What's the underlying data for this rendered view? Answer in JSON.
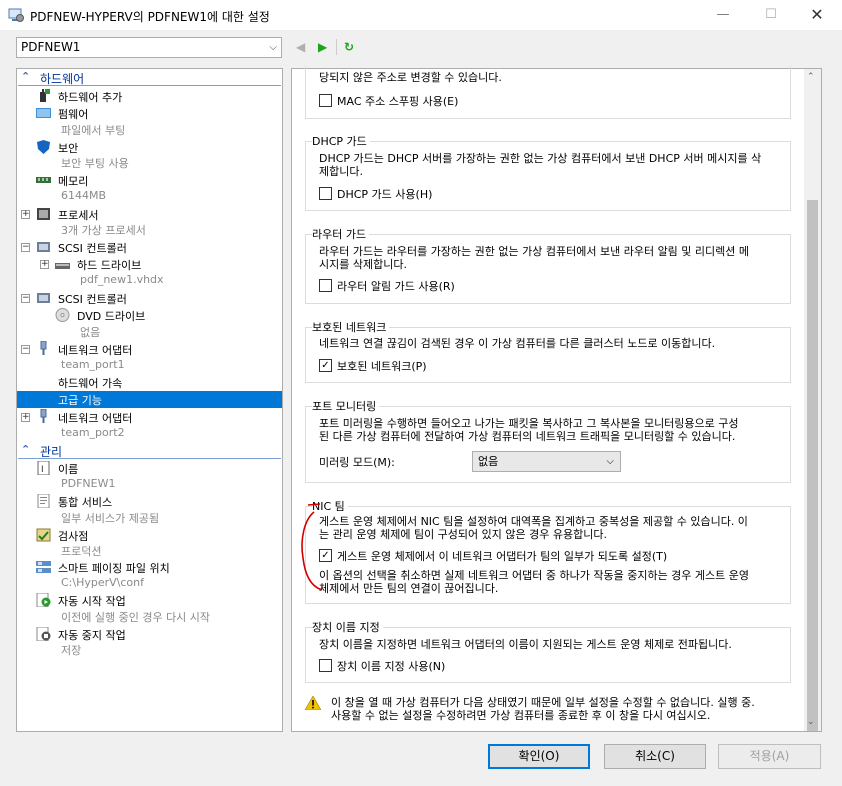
{
  "window": {
    "title": "PDFNEW-HYPERV의 PDFNEW1에 대한 설정",
    "minimize": "—",
    "maximize": "☐",
    "close": "✕"
  },
  "vm_select": {
    "value": "PDFNEW1"
  },
  "sidebar": {
    "hardware_header": "하드웨어",
    "management_header": "관리",
    "items": [
      {
        "label": "하드웨어 추가"
      },
      {
        "label": "펌웨어",
        "sub": "파일에서 부팅"
      },
      {
        "label": "보안",
        "sub": "보안 부팅 사용"
      },
      {
        "label": "메모리",
        "sub": "6144MB"
      },
      {
        "label": "프로세서",
        "sub": "3개 가상 프로세서"
      },
      {
        "label": "SCSI 컨트롤러"
      },
      {
        "label": "하드 드라이브",
        "sub": "pdf_new1.vhdx"
      },
      {
        "label": "SCSI 컨트롤러"
      },
      {
        "label": "DVD 드라이브",
        "sub": "없음"
      },
      {
        "label": "네트워크 어댑터",
        "sub": "team_port1"
      },
      {
        "label": "하드웨어 가속"
      },
      {
        "label": "고급 기능"
      },
      {
        "label": "네트워크 어댑터",
        "sub": "team_port2"
      }
    ],
    "mgmt_items": [
      {
        "label": "이름",
        "sub": "PDFNEW1"
      },
      {
        "label": "통합 서비스",
        "sub": "일부 서비스가 제공됨"
      },
      {
        "label": "검사점",
        "sub": "프로덕션"
      },
      {
        "label": "스마트 페이징 파일 위치",
        "sub": "C:\\HyperV\\conf"
      },
      {
        "label": "자동 시작 작업",
        "sub": "이전에 실행 중인 경우 다시 시작"
      },
      {
        "label": "자동 중지 작업",
        "sub": "저장"
      }
    ]
  },
  "main": {
    "mac": {
      "top_text": "당되지 않은 주소로 변경할 수 있습니다.",
      "checkbox": "MAC 주소 스푸핑 사용(E)",
      "checked": false
    },
    "dhcp": {
      "title": "DHCP 가드",
      "line1": "DHCP 가드는 DHCP 서버를 가장하는 권한 없는 가상 컴퓨터에서 보낸 DHCP 서버 메시지를 삭",
      "line2": "제합니다.",
      "checkbox": "DHCP 가드 사용(H)",
      "checked": false
    },
    "router": {
      "title": "라우터 가드",
      "line1": "라우터 가드는 라우터를 가장하는 권한 없는 가상 컴퓨터에서 보낸 라우터 알림 및 리디렉션 메",
      "line2": "시지를 삭제합니다.",
      "checkbox": "라우터 알림 가드 사용(R)",
      "checked": false
    },
    "protected": {
      "title": "보호된 네트워크",
      "line1": "네트워크 연결 끊김이 검색된 경우 이 가상 컴퓨터를 다른 클러스터 노드로 이동합니다.",
      "checkbox": "보호된 네트워크(P)",
      "checked": true
    },
    "port_monitor": {
      "title": "포트 모니터링",
      "line1": "포트 미러링을 수행하면 들어오고 나가는 패킷을 복사하고 그 복사본을 모니터링용으로 구성",
      "line2": "된 다른 가상 컴퓨터에 전달하여 가상 컴퓨터의 네트워크 트래픽을 모니터링할 수 있습니다.",
      "mode_label": "미러링 모드(M):",
      "mode_value": "없음"
    },
    "nic_team": {
      "title": "NIC 팀",
      "line1": "게스트 운영 체제에서 NIC 팀을 설정하여 대역폭을 집계하고 중복성을 제공할 수 있습니다. 이",
      "line2": "는 관리 운영 체제에 팀이 구성되어 있지 않은 경우 유용합니다.",
      "checkbox": "게스트 운영 체제에서 이 네트워크 어댑터가 팀의 일부가 되도록 설정(T)",
      "checked": true,
      "note1": "이 옵션의 선택을 취소하면 실제 네트워크 어댑터 중 하나가 작동을 중지하는 경우 게스트 운영",
      "note2": "체제에서 만든 팀의 연결이 끊어집니다."
    },
    "device_naming": {
      "title": "장치 이름 지정",
      "line1": "장치 이름을 지정하면 네트워크 어댑터의 이름이 지원되는 게스트 운영 체제로 전파됩니다.",
      "checkbox": "장치 이름 지정 사용(N)",
      "checked": false
    },
    "warning": {
      "line1": "이 창을 열 때 가상 컴퓨터가 다음 상태였기 때문에 일부 설정을 수정할 수 없습니다. 실행 중.",
      "line2": "사용할 수 없는 설정을 수정하려면 가상 컴퓨터를 종료한 후 이 창을 다시 여십시오."
    }
  },
  "buttons": {
    "ok": "확인(O)",
    "cancel": "취소(C)",
    "apply": "적용(A)"
  },
  "colors": {
    "selection": "#0078d7",
    "header_text": "#003399",
    "annotation": "#d40000"
  }
}
